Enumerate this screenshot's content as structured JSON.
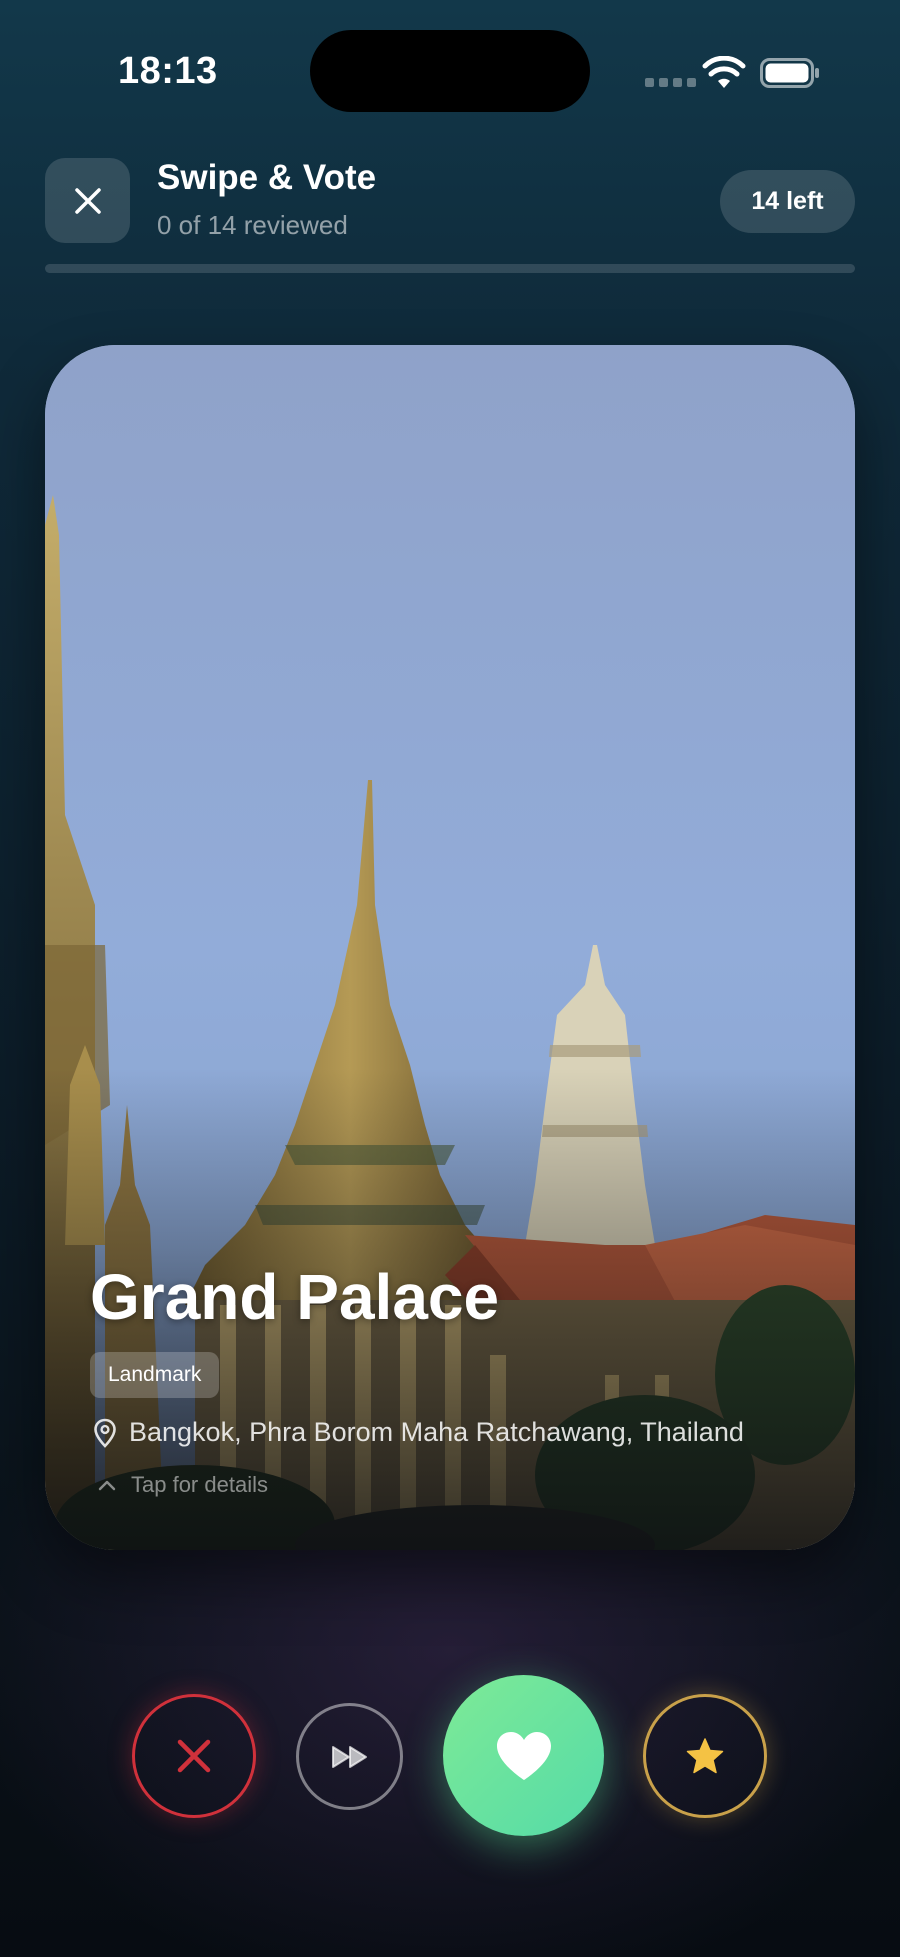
{
  "status_bar": {
    "time": "18:13",
    "icons": [
      "cellular-signal-icon",
      "wifi-icon",
      "battery-icon"
    ]
  },
  "header": {
    "close_icon": "close-icon",
    "title": "Swipe & Vote",
    "subtitle": "0 of 14 reviewed",
    "remaining_badge": "14 left",
    "progress_fraction": 0
  },
  "card": {
    "name": "Grand Palace",
    "category": "Landmark",
    "location_icon": "map-pin-icon",
    "location": "Bangkok, Phra Borom Maha Ratchawang, Thailand",
    "hint_icon": "chevron-up-icon",
    "hint": "Tap for details"
  },
  "actions": [
    {
      "name": "nope",
      "icon": "x-icon",
      "color": "#d0313b"
    },
    {
      "name": "skip",
      "icon": "fast-forward-icon",
      "color": "#ffffff"
    },
    {
      "name": "like",
      "icon": "heart-icon",
      "color": "#5fe0a0"
    },
    {
      "name": "super-like",
      "icon": "star-icon",
      "color": "#f4c244"
    }
  ],
  "colors": {
    "accent_green": "#5fe0a0",
    "danger_red": "#d0313b",
    "gold": "#f4c244",
    "background_top": "#12384a",
    "background_bottom": "#070c12"
  }
}
